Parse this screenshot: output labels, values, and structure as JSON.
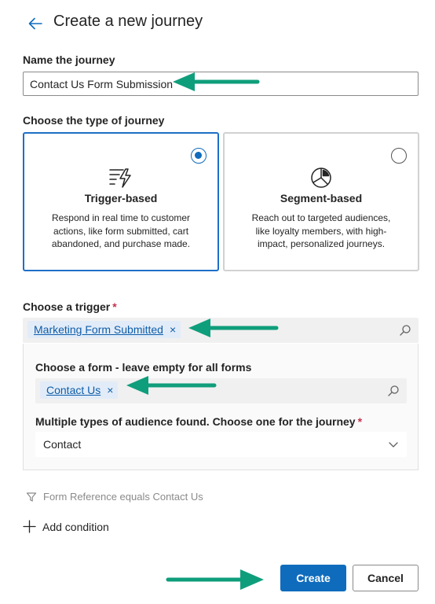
{
  "header": {
    "title": "Create a new journey",
    "back_icon": "arrow-left-icon"
  },
  "name_section": {
    "label": "Name the journey",
    "value": "Contact Us Form Submission"
  },
  "type_section": {
    "label": "Choose the type of journey",
    "cards": [
      {
        "title": "Trigger-based",
        "description": "Respond in real time to customer actions, like form submitted, cart abandoned, and purchase made.",
        "selected": true,
        "icon": "trigger-lightning-icon"
      },
      {
        "title": "Segment-based",
        "description": "Reach out to targeted audiences, like loyalty members, with high-impact, personalized journeys.",
        "selected": false,
        "icon": "pie-chart-icon"
      }
    ]
  },
  "trigger_section": {
    "label": "Choose a trigger",
    "required_mark": "*",
    "selected_trigger": "Marketing Form Submitted",
    "remove_glyph": "×",
    "form_label": "Choose a form - leave empty for all forms",
    "selected_form": "Contact Us",
    "audience_label": "Multiple types of audience found. Choose one for the journey",
    "audience_value": "Contact"
  },
  "filter": {
    "text": "Form Reference equals Contact Us"
  },
  "add_condition": {
    "label": "Add condition"
  },
  "footer": {
    "create_label": "Create",
    "cancel_label": "Cancel"
  },
  "colors": {
    "accent": "#0f6cbd",
    "annotation_arrow": "#0f9e7b",
    "required": "#c4314b"
  }
}
